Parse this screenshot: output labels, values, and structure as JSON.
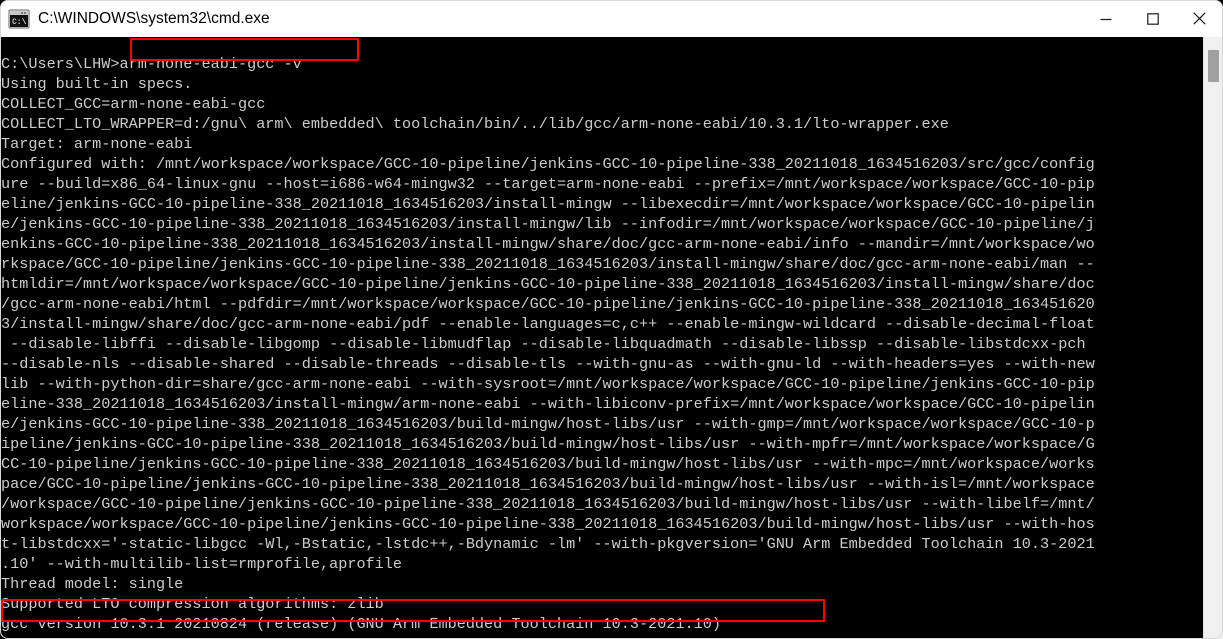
{
  "window": {
    "title": "C:\\WINDOWS\\system32\\cmd.exe",
    "icon": "cmd-console-icon",
    "background": "#000000",
    "titlebar_background": "#ffffff",
    "text_color": "#cccccc",
    "highlight_color": "#ff0000"
  },
  "titlebar": {
    "minimize_label": "Minimize",
    "maximize_label": "Maximize",
    "close_label": "Close"
  },
  "scrollbar": {
    "thumb_label": "scroll-thumb"
  },
  "terminal": {
    "prompt": "C:\\Users\\LHW>",
    "command": "arm-none-eabi-gcc -v",
    "highlighted_command": "arm-none-eabi-gcc -v",
    "highlighted_version_line": "gcc version 10.3.1 20210824 (release) (GNU Arm Embedded Toolchain 10.3-2021.10)",
    "output": "C:\\Users\\LHW>arm-none-eabi-gcc -v\nUsing built-in specs.\nCOLLECT_GCC=arm-none-eabi-gcc\nCOLLECT_LTO_WRAPPER=d:/gnu\\ arm\\ embedded\\ toolchain/bin/../lib/gcc/arm-none-eabi/10.3.1/lto-wrapper.exe\nTarget: arm-none-eabi\nConfigured with: /mnt/workspace/workspace/GCC-10-pipeline/jenkins-GCC-10-pipeline-338_20211018_1634516203/src/gcc/config\nure --build=x86_64-linux-gnu --host=i686-w64-mingw32 --target=arm-none-eabi --prefix=/mnt/workspace/workspace/GCC-10-pip\neline/jenkins-GCC-10-pipeline-338_20211018_1634516203/install-mingw --libexecdir=/mnt/workspace/workspace/GCC-10-pipelin\ne/jenkins-GCC-10-pipeline-338_20211018_1634516203/install-mingw/lib --infodir=/mnt/workspace/workspace/GCC-10-pipeline/j\nenkins-GCC-10-pipeline-338_20211018_1634516203/install-mingw/share/doc/gcc-arm-none-eabi/info --mandir=/mnt/workspace/wo\nrkspace/GCC-10-pipeline/jenkins-GCC-10-pipeline-338_20211018_1634516203/install-mingw/share/doc/gcc-arm-none-eabi/man --\nhtmldir=/mnt/workspace/workspace/GCC-10-pipeline/jenkins-GCC-10-pipeline-338_20211018_1634516203/install-mingw/share/doc\n/gcc-arm-none-eabi/html --pdfdir=/mnt/workspace/workspace/GCC-10-pipeline/jenkins-GCC-10-pipeline-338_20211018_163451620\n3/install-mingw/share/doc/gcc-arm-none-eabi/pdf --enable-languages=c,c++ --enable-mingw-wildcard --disable-decimal-float\n --disable-libffi --disable-libgomp --disable-libmudflap --disable-libquadmath --disable-libssp --disable-libstdcxx-pch\n--disable-nls --disable-shared --disable-threads --disable-tls --with-gnu-as --with-gnu-ld --with-headers=yes --with-new\nlib --with-python-dir=share/gcc-arm-none-eabi --with-sysroot=/mnt/workspace/workspace/GCC-10-pipeline/jenkins-GCC-10-pip\neline-338_20211018_1634516203/install-mingw/arm-none-eabi --with-libiconv-prefix=/mnt/workspace/workspace/GCC-10-pipelin\ne/jenkins-GCC-10-pipeline-338_20211018_1634516203/build-mingw/host-libs/usr --with-gmp=/mnt/workspace/workspace/GCC-10-p\nipeline/jenkins-GCC-10-pipeline-338_20211018_1634516203/build-mingw/host-libs/usr --with-mpfr=/mnt/workspace/workspace/G\nCC-10-pipeline/jenkins-GCC-10-pipeline-338_20211018_1634516203/build-mingw/host-libs/usr --with-mpc=/mnt/workspace/works\npace/GCC-10-pipeline/jenkins-GCC-10-pipeline-338_20211018_1634516203/build-mingw/host-libs/usr --with-isl=/mnt/workspace\n/workspace/GCC-10-pipeline/jenkins-GCC-10-pipeline-338_20211018_1634516203/build-mingw/host-libs/usr --with-libelf=/mnt/\nworkspace/workspace/GCC-10-pipeline/jenkins-GCC-10-pipeline-338_20211018_1634516203/build-mingw/host-libs/usr --with-hos\nt-libstdcxx='-static-libgcc -Wl,-Bstatic,-lstdc++,-Bdynamic -lm' --with-pkgversion='GNU Arm Embedded Toolchain 10.3-2021\n.10' --with-multilib-list=rmprofile,aprofile\nThread model: single\nSupported LTO compression algorithms: zlib\ngcc version 10.3.1 20210824 (release) (GNU Arm Embedded Toolchain 10.3-2021.10)"
  }
}
